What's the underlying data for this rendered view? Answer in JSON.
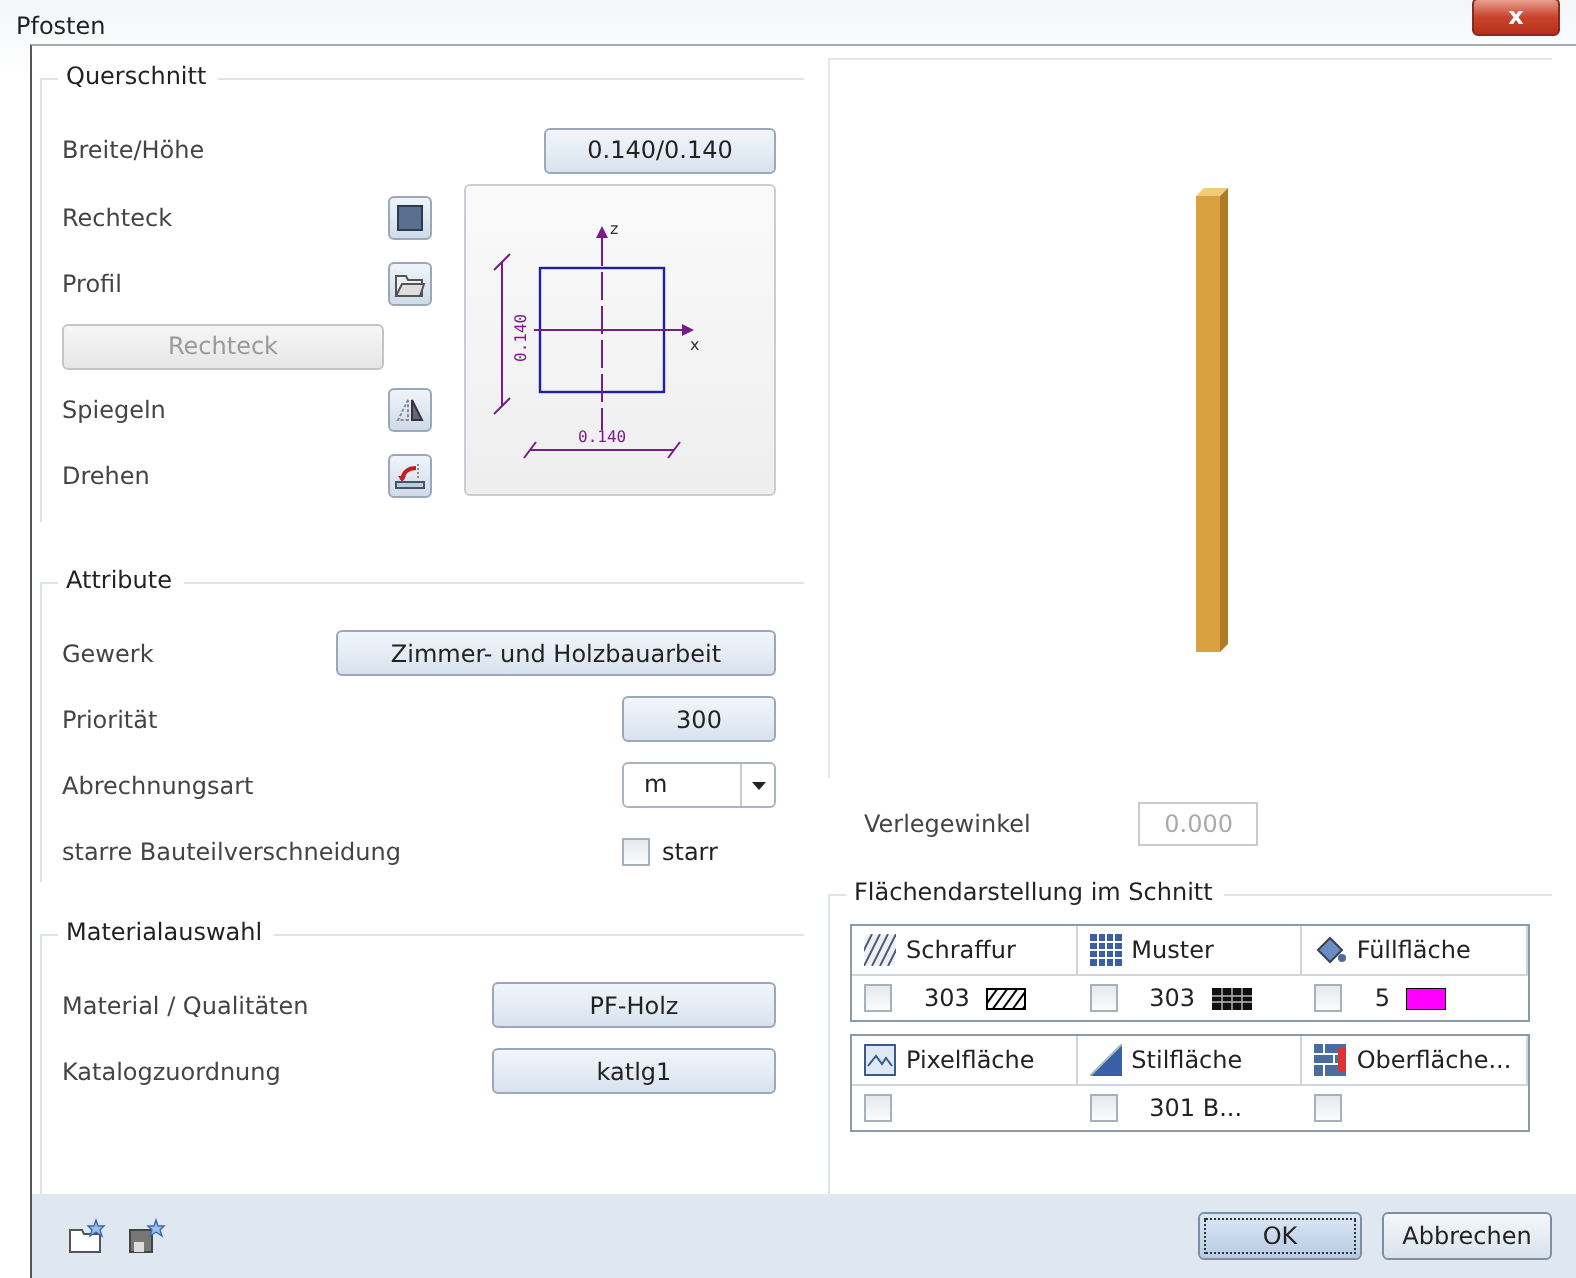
{
  "window": {
    "title": "Pfosten",
    "close": "x"
  },
  "querschnitt": {
    "title": "Querschnitt",
    "size": {
      "label": "Breite/Höhe",
      "value": "0.140/0.140"
    },
    "rechteck": {
      "label": "Rechteck"
    },
    "profil": {
      "label": "Profil"
    },
    "profile_name": {
      "label": "Rechteck",
      "disabled": true
    },
    "spiegeln": {
      "label": "Spiegeln"
    },
    "drehen": {
      "label": "Drehen"
    },
    "diagram": {
      "z_axis": "z",
      "x_axis": "x",
      "height_label": "0.140",
      "width_label": "0.140"
    }
  },
  "attribute": {
    "title": "Attribute",
    "gewerk": {
      "label": "Gewerk",
      "value": "Zimmer- und Holzbauarbeit"
    },
    "prioritaet": {
      "label": "Priorität",
      "value": "300"
    },
    "abrechnungsart": {
      "label": "Abrechnungsart",
      "value": "m"
    },
    "verschneidung": {
      "label": "starre Bauteilverschneidung",
      "checkbox_label": "starr",
      "checked": false
    }
  },
  "materialauswahl": {
    "title": "Materialauswahl",
    "rows": [
      {
        "label": "Material / Qualitäten",
        "value": "PF-Holz"
      },
      {
        "label": "Katalogzuordnung",
        "value": "katlg1"
      }
    ]
  },
  "verlegewinkel": {
    "label": "Verlegewinkel",
    "value": "0.000",
    "disabled": true
  },
  "flaechendarstellung": {
    "title": "Flächendarstellung im Schnitt",
    "groups": [
      {
        "columns": [
          {
            "kind": "hatch",
            "header": "Schraffur",
            "checked": false,
            "value": "303"
          },
          {
            "kind": "pattern",
            "header": "Muster",
            "checked": false,
            "value": "303"
          },
          {
            "kind": "fill",
            "header": "Füllfläche",
            "checked": false,
            "value": "5",
            "color": "#ff00ff"
          }
        ]
      },
      {
        "columns": [
          {
            "kind": "pixel",
            "header": "Pixelfläche",
            "checked": false
          },
          {
            "kind": "style",
            "header": "Stilfläche",
            "checked": false,
            "value": "301 B..."
          },
          {
            "kind": "surface",
            "header": "Oberfläche...",
            "checked": false
          }
        ]
      }
    ]
  },
  "footer": {
    "buttons": [
      {
        "label": "OK",
        "default": true
      },
      {
        "label": "Abbrechen",
        "default": false
      }
    ]
  }
}
